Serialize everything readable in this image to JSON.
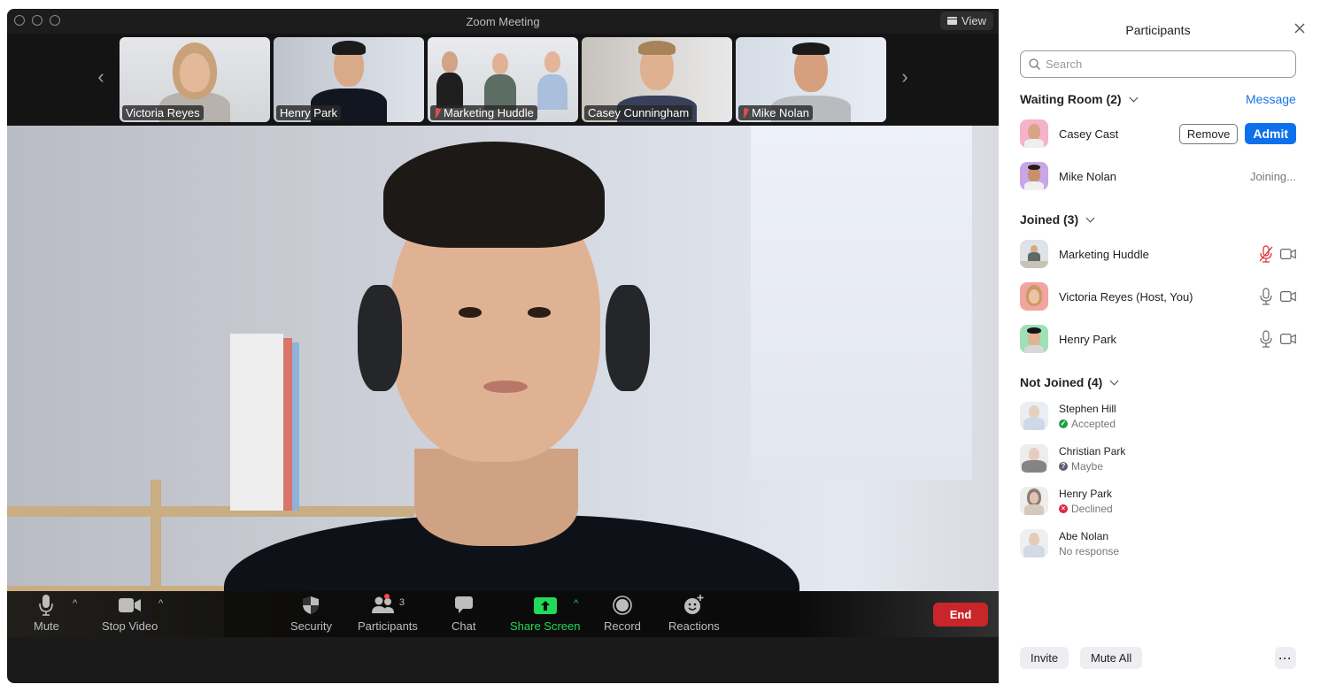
{
  "window": {
    "title": "Zoom Meeting",
    "view_label": "View"
  },
  "gallery": {
    "tiles": [
      {
        "name": "Victoria Reyes",
        "muted": false,
        "active": false
      },
      {
        "name": "Henry Park",
        "muted": false,
        "active": true
      },
      {
        "name": "Marketing Huddle",
        "muted": true,
        "active": false
      },
      {
        "name": "Casey Cunningham",
        "muted": false,
        "active": false
      },
      {
        "name": "Mike Nolan",
        "muted": true,
        "active": false
      }
    ]
  },
  "main_video": {
    "speaker": "Henry Park"
  },
  "toolbar": {
    "mute": "Mute",
    "stop_video": "Stop Video",
    "security": "Security",
    "participants": "Participants",
    "participants_count": "3",
    "chat": "Chat",
    "share_screen": "Share Screen",
    "record": "Record",
    "reactions": "Reactions",
    "end": "End",
    "share_color": "#23d959",
    "end_color": "#c8262a"
  },
  "panel": {
    "title": "Participants",
    "search_placeholder": "Search",
    "waiting_room": {
      "header": "Waiting Room (2)",
      "message_link": "Message",
      "people": [
        {
          "name": "Casey Cast",
          "remove": "Remove",
          "admit": "Admit"
        },
        {
          "name": "Mike Nolan",
          "status": "Joining..."
        }
      ]
    },
    "joined": {
      "header": "Joined (3)",
      "people": [
        {
          "name": "Marketing Huddle",
          "mic": "muted",
          "video": "on"
        },
        {
          "name": "Victoria Reyes (Host, You)",
          "mic": "on",
          "video": "on"
        },
        {
          "name": "Henry Park",
          "mic": "on",
          "video": "on"
        }
      ]
    },
    "not_joined": {
      "header": "Not Joined (4)",
      "people": [
        {
          "name": "Stephen Hill",
          "status": "Accepted",
          "status_icon": "check-circle"
        },
        {
          "name": "Christian Park",
          "status": "Maybe",
          "status_icon": "question-circle"
        },
        {
          "name": "Henry Park",
          "status": "Declined",
          "status_icon": "x-circle"
        },
        {
          "name": "Abe Nolan",
          "status": "No response",
          "status_icon": "none"
        }
      ]
    },
    "footer": {
      "invite": "Invite",
      "mute_all": "Mute All",
      "more": "···"
    },
    "accent": "#0e71eb"
  }
}
